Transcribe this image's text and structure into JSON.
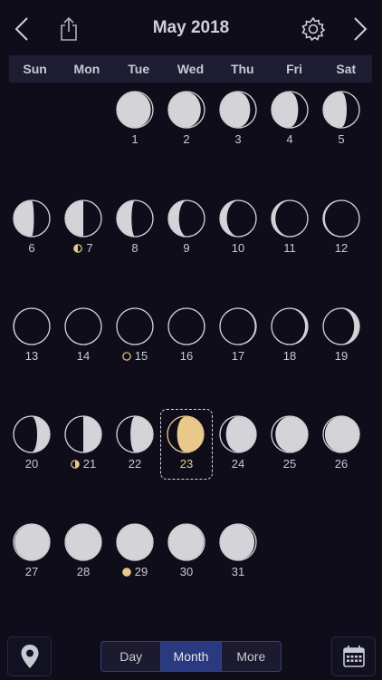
{
  "header": {
    "title": "May 2018"
  },
  "weekdays": [
    "Sun",
    "Mon",
    "Tue",
    "Wed",
    "Thu",
    "Fri",
    "Sat"
  ],
  "days": [
    {
      "label": "1",
      "phase": 0.57,
      "col": 2,
      "row": 0
    },
    {
      "label": "2",
      "phase": 0.6,
      "col": 3,
      "row": 0
    },
    {
      "label": "3",
      "phase": 0.63,
      "col": 4,
      "row": 0
    },
    {
      "label": "4",
      "phase": 0.67,
      "col": 5,
      "row": 0
    },
    {
      "label": "5",
      "phase": 0.7,
      "col": 6,
      "row": 0
    },
    {
      "label": "6",
      "phase": 0.73,
      "col": 0,
      "row": 1
    },
    {
      "label": "7",
      "phase": 0.75,
      "col": 1,
      "row": 1,
      "marker": "last-quarter"
    },
    {
      "label": "8",
      "phase": 0.78,
      "col": 2,
      "row": 1
    },
    {
      "label": "9",
      "phase": 0.82,
      "col": 3,
      "row": 1
    },
    {
      "label": "10",
      "phase": 0.86,
      "col": 4,
      "row": 1
    },
    {
      "label": "11",
      "phase": 0.9,
      "col": 5,
      "row": 1
    },
    {
      "label": "12",
      "phase": 0.94,
      "col": 6,
      "row": 1
    },
    {
      "label": "13",
      "phase": 0.97,
      "col": 0,
      "row": 2
    },
    {
      "label": "14",
      "phase": 0.99,
      "col": 1,
      "row": 2
    },
    {
      "label": "15",
      "phase": 0.0,
      "col": 2,
      "row": 2,
      "marker": "new"
    },
    {
      "label": "16",
      "phase": 0.02,
      "col": 3,
      "row": 2
    },
    {
      "label": "17",
      "phase": 0.05,
      "col": 4,
      "row": 2
    },
    {
      "label": "18",
      "phase": 0.08,
      "col": 5,
      "row": 2
    },
    {
      "label": "19",
      "phase": 0.12,
      "col": 6,
      "row": 2
    },
    {
      "label": "20",
      "phase": 0.2,
      "col": 0,
      "row": 3
    },
    {
      "label": "21",
      "phase": 0.25,
      "col": 1,
      "row": 3,
      "marker": "first-quarter"
    },
    {
      "label": "22",
      "phase": 0.29,
      "col": 2,
      "row": 3
    },
    {
      "label": "23",
      "phase": 0.33,
      "col": 3,
      "row": 3,
      "today": true
    },
    {
      "label": "24",
      "phase": 0.37,
      "col": 4,
      "row": 3
    },
    {
      "label": "25",
      "phase": 0.4,
      "col": 5,
      "row": 3
    },
    {
      "label": "26",
      "phase": 0.44,
      "col": 6,
      "row": 3
    },
    {
      "label": "27",
      "phase": 0.46,
      "col": 0,
      "row": 4
    },
    {
      "label": "28",
      "phase": 0.48,
      "col": 1,
      "row": 4
    },
    {
      "label": "29",
      "phase": 0.5,
      "col": 2,
      "row": 4,
      "marker": "full"
    },
    {
      "label": "30",
      "phase": 0.53,
      "col": 3,
      "row": 4
    },
    {
      "label": "31",
      "phase": 0.56,
      "col": 4,
      "row": 4
    }
  ],
  "bottom": {
    "tabs": [
      {
        "label": "Day",
        "active": false
      },
      {
        "label": "Month",
        "active": true
      },
      {
        "label": "More",
        "active": false
      }
    ]
  },
  "colors": {
    "accent": "#e9c98a",
    "moon_light": "#d4d4d8",
    "moon_dark": "#0f0d1a",
    "active_tab": "#2a3a80"
  },
  "icons": {
    "back": "chevron-left-icon",
    "share": "share-icon",
    "settings": "gear-icon",
    "forward": "chevron-right-icon",
    "location": "location-pin-icon",
    "calendar": "calendar-icon"
  }
}
